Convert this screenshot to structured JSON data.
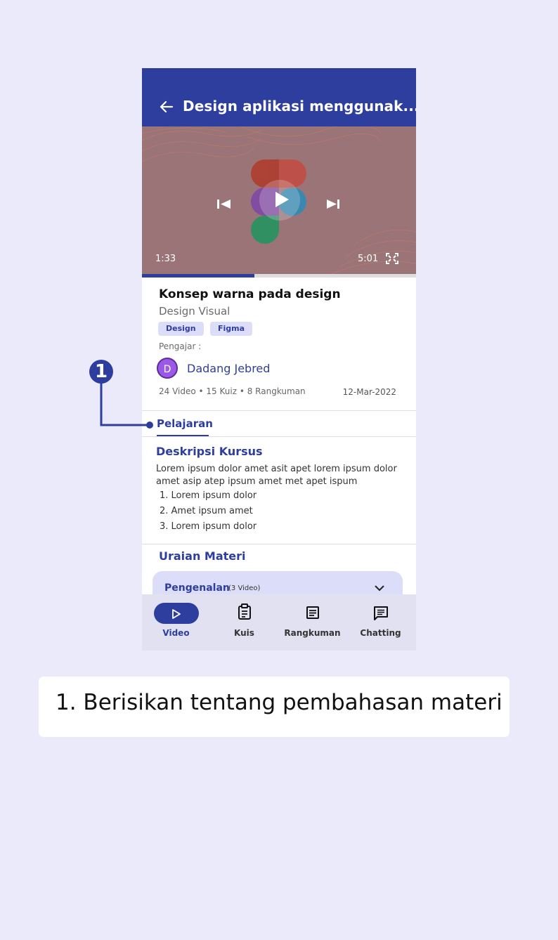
{
  "appbar": {
    "title": "Design aplikasi menggunak..."
  },
  "video": {
    "current_time": "1:33",
    "total_time": "5:01",
    "progress": 0.41
  },
  "course": {
    "title": "Konsep warna pada design",
    "subtitle": "Design Visual",
    "tags": [
      "Design",
      "Figma"
    ],
    "teacher_label": "Pengajar :",
    "teacher_initial": "D",
    "teacher_name": "Dadang Jebred",
    "meta": "24 Video • 15 Kuiz • 8 Rangkuman",
    "date": "12-Mar-2022"
  },
  "tabs": {
    "active": "Pelajaran"
  },
  "description": {
    "title": "Deskripsi Kursus",
    "text": "Lorem ipsum dolor amet asit apet lorem ipsum dolor amet asip atep ipsum amet met apet ispum",
    "items": [
      "1. Lorem ipsum dolor",
      "2. Amet ipsum amet",
      "3. Lorem ipsum dolor"
    ]
  },
  "materi": {
    "title": "Uraian Materi",
    "accordion": {
      "label": "Pengenalan",
      "count": "(3 Video)"
    }
  },
  "bottom_nav": [
    {
      "label": "Video",
      "icon": "play-icon",
      "active": true
    },
    {
      "label": "Kuis",
      "icon": "clipboard-icon",
      "active": false
    },
    {
      "label": "Rangkuman",
      "icon": "document-icon",
      "active": false
    },
    {
      "label": "Chatting",
      "icon": "chat-icon",
      "active": false
    }
  ],
  "annotation": {
    "marker": "1",
    "note": "1. Berisikan tentang pembahasan materi"
  },
  "colors": {
    "primary": "#2E3E9E",
    "background": "#EBEAFB",
    "chip": "#DCDDF8"
  }
}
